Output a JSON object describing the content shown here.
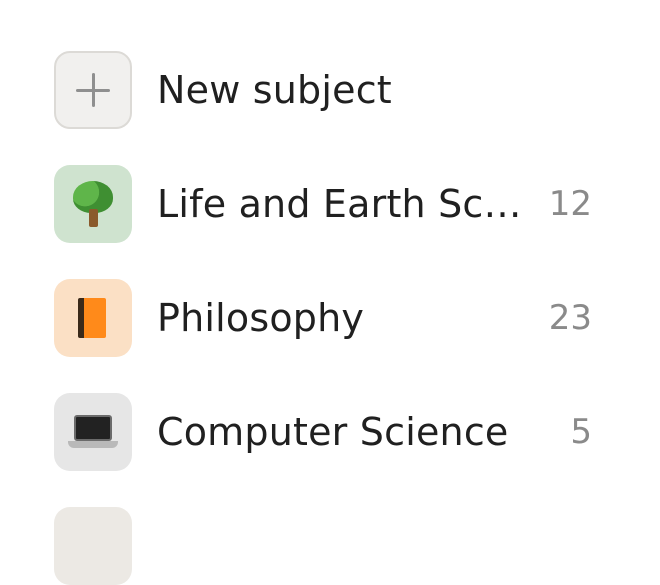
{
  "new_subject": {
    "label": "New subject",
    "icon": "plus-icon"
  },
  "subjects": [
    {
      "label": "Life and Earth Sci…",
      "count": "12",
      "icon": "tree-icon",
      "tile_color": "#cfe3cf"
    },
    {
      "label": "Philosophy",
      "count": "23",
      "icon": "book-icon",
      "tile_color": "#fbe0c5"
    },
    {
      "label": "Computer Science",
      "count": "5",
      "icon": "laptop-icon",
      "tile_color": "#e6e6e6"
    },
    {
      "label": "",
      "count": "",
      "icon": "subject-icon",
      "tile_color": "#ece9e4"
    }
  ]
}
